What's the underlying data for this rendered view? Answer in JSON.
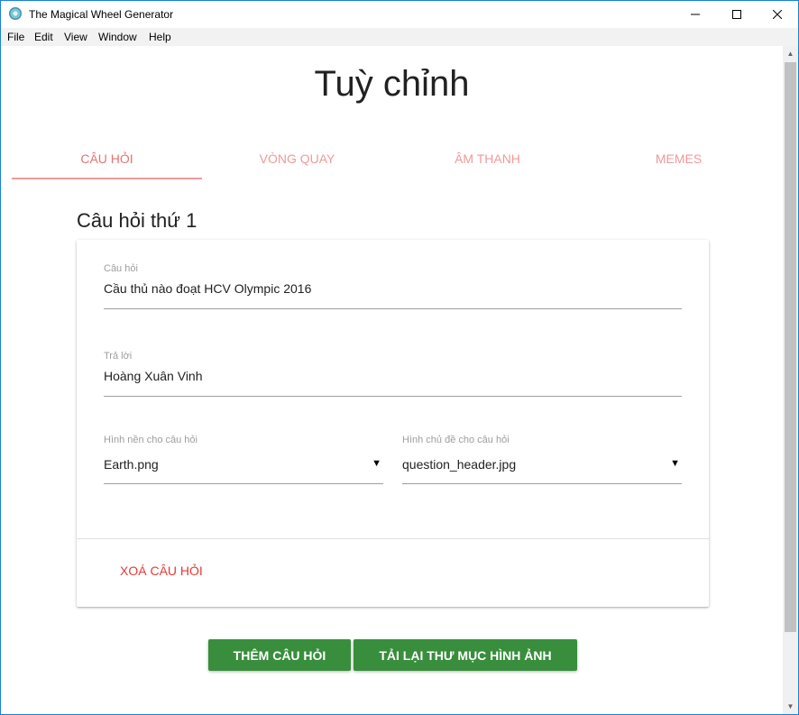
{
  "window": {
    "title": "The Magical Wheel Generator",
    "controls": {
      "minimize_icon": "minimize-icon",
      "maximize_icon": "maximize-icon",
      "close_icon": "close-icon"
    }
  },
  "menu": {
    "items": [
      "File",
      "Edit",
      "View",
      "Window",
      "Help"
    ]
  },
  "page": {
    "title": "Tuỳ chỉnh",
    "tabs": [
      {
        "label": "CÂU HỎI",
        "active": true
      },
      {
        "label": "VÒNG QUAY",
        "active": false
      },
      {
        "label": "ÂM THANH",
        "active": false
      },
      {
        "label": "MEMES",
        "active": false
      }
    ],
    "section_title": "Câu hỏi thứ 1"
  },
  "question_card": {
    "question": {
      "label": "Câu hỏi",
      "value": "Cầu thủ nào đoạt HCV Olympic 2016"
    },
    "answer": {
      "label": "Trả lời",
      "value": "Hoàng Xuân Vinh"
    },
    "background_select": {
      "label": "Hình nền cho câu hỏi",
      "value": "Earth.png"
    },
    "header_select": {
      "label": "Hình chủ đề cho câu hỏi",
      "value": "question_header.jpg"
    },
    "delete_label": "XOÁ CÂU HỎI"
  },
  "actions": {
    "add_question": "THÊM CÂU HỎI",
    "reload_images": "TẢI LẠI THƯ MỤC HÌNH ẢNH"
  },
  "colors": {
    "accent_tab": "#ef9a9a",
    "delete_text": "#e53935",
    "button_green": "#388e3c",
    "window_border": "#1883d7"
  }
}
